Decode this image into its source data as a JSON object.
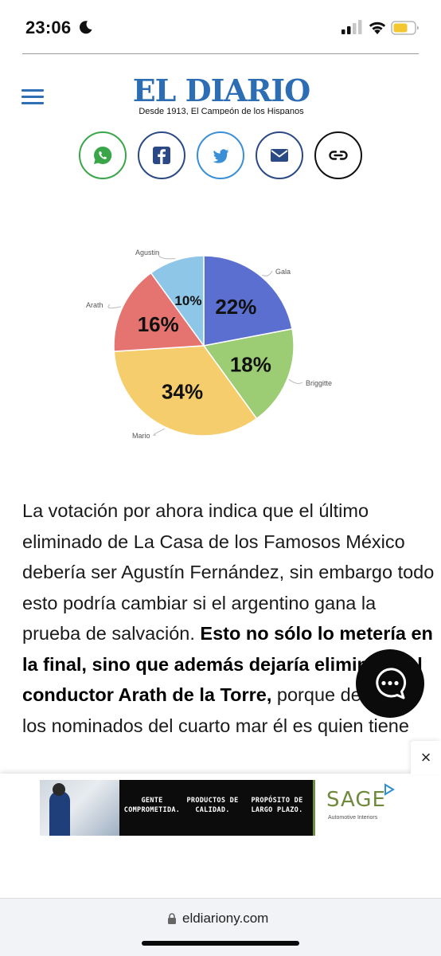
{
  "status_bar": {
    "time": "23:06"
  },
  "header": {
    "logo_text": "EL DIARIO",
    "logo_tagline": "Desde 1913, El Campeón de los Hispanos"
  },
  "share_buttons": [
    {
      "name": "whatsapp",
      "icon": "whatsapp-icon",
      "color": "#3aa64a"
    },
    {
      "name": "facebook",
      "icon": "facebook-icon",
      "color": "#2b4a85"
    },
    {
      "name": "twitter",
      "icon": "twitter-icon",
      "color": "#3a8fd6"
    },
    {
      "name": "email",
      "icon": "mail-icon",
      "color": "#2b4a85"
    },
    {
      "name": "copy-link",
      "icon": "link-icon",
      "color": "#111111"
    }
  ],
  "chart_data": {
    "type": "pie",
    "categories": [
      "Gala",
      "Briggitte",
      "Mario",
      "Arath",
      "Agustin"
    ],
    "values": [
      22,
      18,
      34,
      16,
      10
    ],
    "value_labels": [
      "22%",
      "18%",
      "34%",
      "16%",
      "10%"
    ],
    "colors": [
      "#5b6fd0",
      "#9ccd74",
      "#f5cd6d",
      "#e57470",
      "#8ec6e7"
    ]
  },
  "article": {
    "p1": "La votación por ahora indica que el último eliminado de La Casa de los Famosos México debería ser Agustín Fernández, sin embargo todo esto podría cambiar si el argentino gana la prueba de salvación. ",
    "p1_bold": "Esto no sólo lo metería en la final, sino que además dejaría eliminado al conductor Arath de la Torre,",
    "p1_end": " porque de todos los nominados del cuarto mar él es quien tiene"
  },
  "ad": {
    "col1": "GENTE COMPROMETIDA.",
    "col2": "PRODUCTOS DE CALIDAD.",
    "col3": "PROPÓSITO DE LARGO PLAZO.",
    "brand": "SAGE",
    "brand_sub": "Automotive Interiors",
    "close_label": "×"
  },
  "browser": {
    "url": "eldiariony.com"
  }
}
